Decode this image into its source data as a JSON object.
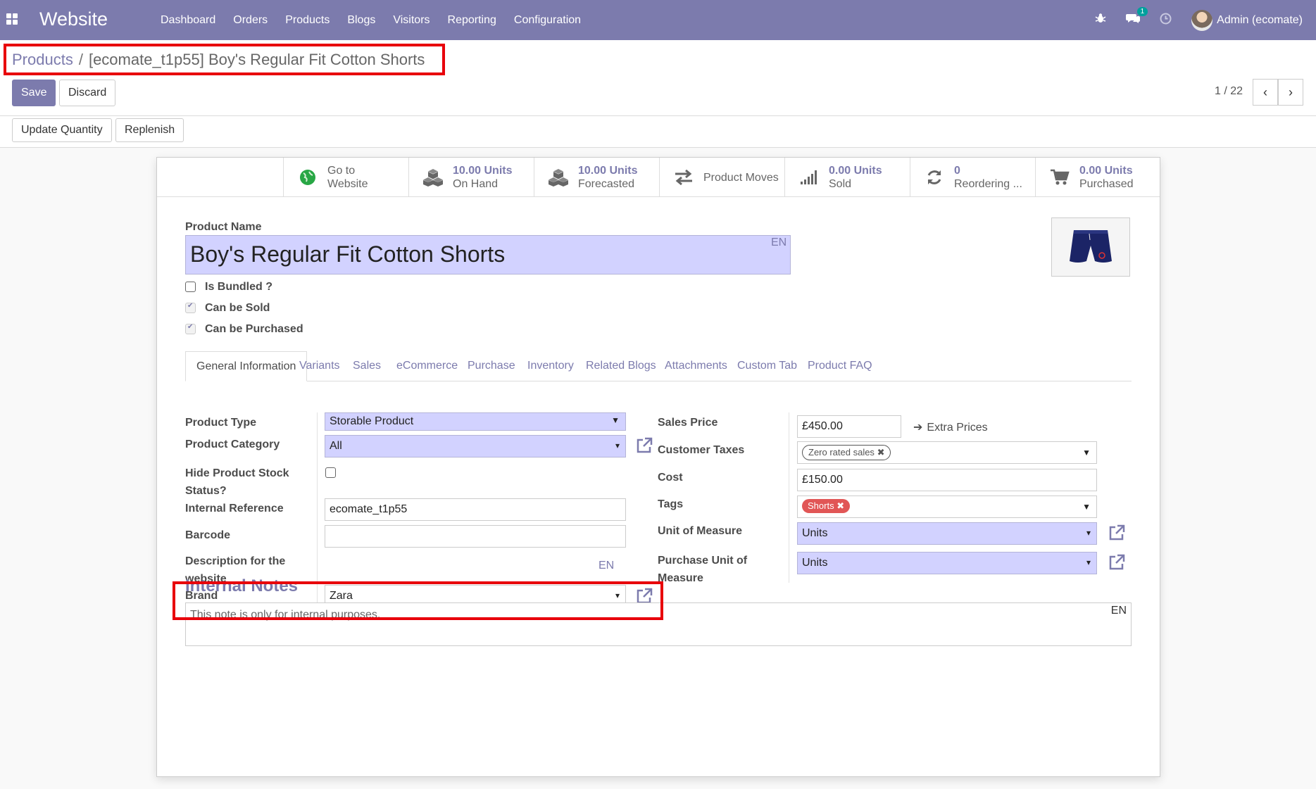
{
  "app": {
    "title": "Website"
  },
  "menu": [
    "Dashboard",
    "Orders",
    "Products",
    "Blogs",
    "Visitors",
    "Reporting",
    "Configuration"
  ],
  "topbar": {
    "message_count": "1",
    "user_name": "Admin (ecomate)"
  },
  "breadcrumb": {
    "parent": "Products",
    "separator": "/",
    "current": "[ecomate_t1p55] Boy's Regular Fit Cotton Shorts"
  },
  "actions": {
    "save": "Save",
    "discard": "Discard",
    "update_quantity": "Update Quantity",
    "replenish": "Replenish"
  },
  "pager": {
    "value": "1 / 22"
  },
  "smart_buttons": [
    {
      "value": "Go to",
      "label": "Website"
    },
    {
      "value": "10.00 Units",
      "label": "On Hand"
    },
    {
      "value": "10.00 Units",
      "label": "Forecasted"
    },
    {
      "value": "",
      "label": "Product Moves"
    },
    {
      "value": "0.00 Units",
      "label": "Sold"
    },
    {
      "value": "0",
      "label": "Reordering ..."
    },
    {
      "value": "0.00 Units",
      "label": "Purchased"
    }
  ],
  "form": {
    "name_label": "Product Name",
    "name": "Boy's Regular Fit Cotton Shorts",
    "lang": "EN",
    "checkboxes": [
      "Is Bundled ?",
      "Can be Sold",
      "Can be Purchased"
    ]
  },
  "tabs": [
    "General Information",
    "Variants",
    "Sales",
    "eCommerce",
    "Purchase",
    "Inventory",
    "Related Blogs",
    "Attachments",
    "Custom Tab",
    "Product FAQ"
  ],
  "general": {
    "product_type_label": "Product Type",
    "product_type": "Storable Product",
    "category_label": "Product Category",
    "category": "All",
    "hide_stock_label": "Hide Product Stock Status?",
    "internal_ref_label": "Internal Reference",
    "internal_ref": "ecomate_t1p55",
    "barcode_label": "Barcode",
    "barcode": "",
    "desc_label": "Description for the website",
    "desc_lang": "EN",
    "brand_label": "Brand",
    "brand": "Zara",
    "sales_price_label": "Sales Price",
    "sales_price": "£450.00",
    "extra_prices": "Extra Prices",
    "customer_taxes_label": "Customer Taxes",
    "customer_tax_tag": "Zero rated sales",
    "cost_label": "Cost",
    "cost": "£150.00",
    "tags_label": "Tags",
    "tag": "Shorts",
    "uom_label": "Unit of Measure",
    "uom": "Units",
    "purchase_uom_label": "Purchase Unit of Measure",
    "purchase_uom": "Units"
  },
  "notes": {
    "title": "Internal Notes",
    "placeholder": "This note is only for internal purposes.",
    "lang": "EN"
  },
  "colors": {
    "brand": "#7c7bad",
    "required_field": "#d2d2ff",
    "highlight": "#e8000b",
    "tag_red": "#e15656"
  }
}
